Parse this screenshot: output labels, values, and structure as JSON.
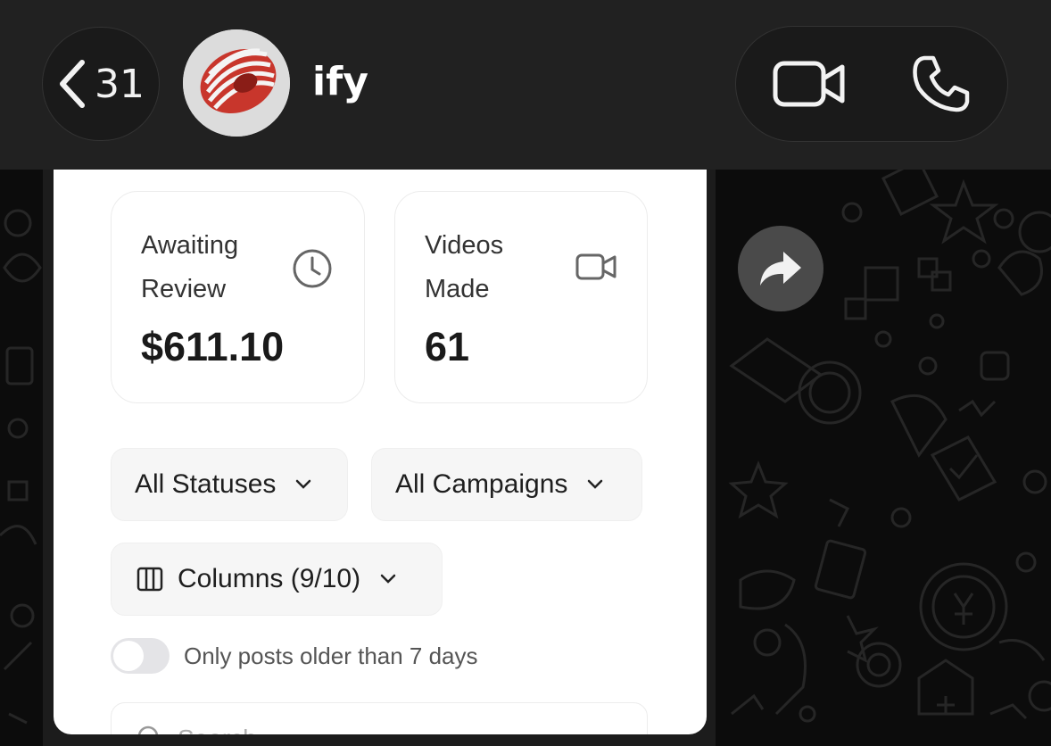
{
  "header": {
    "back_count": "31",
    "contact_name": "ify"
  },
  "stats": [
    {
      "label": "Awaiting Review",
      "value": "$611.10",
      "icon": "clock-icon"
    },
    {
      "label": "Videos Made",
      "value": "61",
      "icon": "video-icon"
    }
  ],
  "filters": {
    "statuses": "All Statuses",
    "campaigns": "All Campaigns",
    "columns": "Columns (9/10)"
  },
  "toggle": {
    "label": "Only posts older than 7 days",
    "checked": false
  },
  "search": {
    "placeholder": "Search..."
  },
  "colors": {
    "topbar": "#212121",
    "card": "#ffffff",
    "forward_button": "#4a4a4a"
  }
}
